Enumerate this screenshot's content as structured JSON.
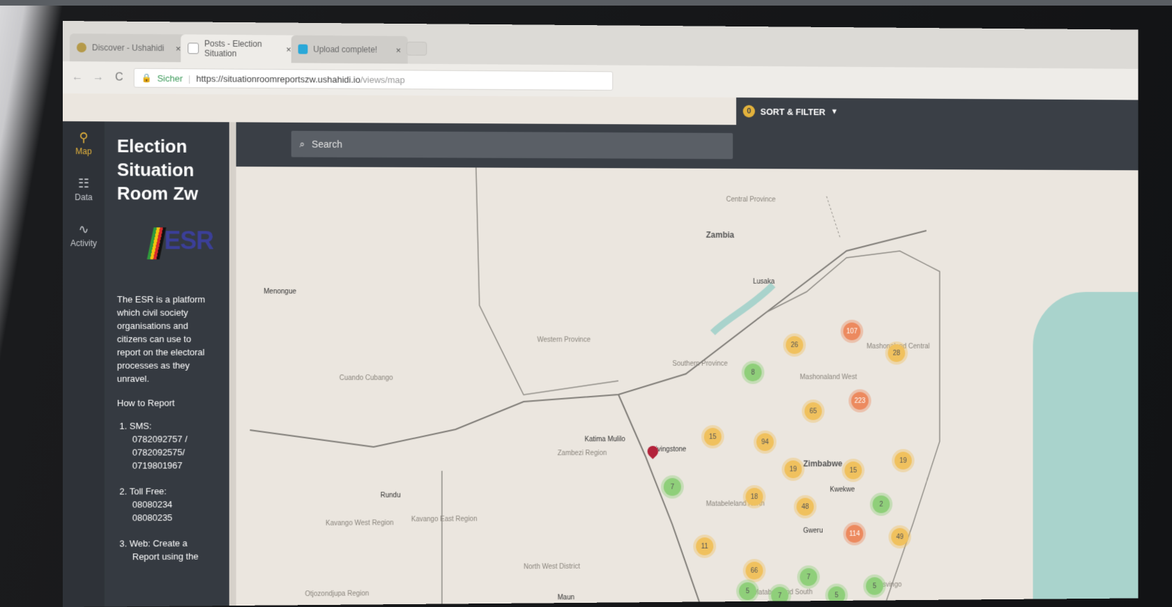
{
  "browser": {
    "tabs": [
      {
        "label": "Discover - Ushahidi",
        "close": "×"
      },
      {
        "label": "Posts - Election Situation",
        "close": "×"
      },
      {
        "label": "Upload complete!",
        "close": "×"
      }
    ],
    "nav": {
      "back": "←",
      "forward": "→",
      "reload": "C"
    },
    "address": {
      "secure_label": "Sicher",
      "host": "https://situationroomreportszw.ushahidi.io",
      "path": "/views/map"
    }
  },
  "rail": {
    "items": [
      {
        "label": "Map",
        "icon": "map-pin-icon"
      },
      {
        "label": "Data",
        "icon": "data-list-icon"
      },
      {
        "label": "Activity",
        "icon": "activity-icon"
      }
    ]
  },
  "panel": {
    "title": "Election Situation Room Zw",
    "logo_text": "ESR",
    "description": "The ESR is a platform which civil society organisations and citizens can use to report on the electoral processes as they unravel.",
    "how_to": "How to Report",
    "steps": [
      {
        "title": "SMS:",
        "lines": [
          "0782092757 /",
          "0782092575/",
          "0719801967"
        ]
      },
      {
        "title": "Toll Free:",
        "lines": [
          "08080234",
          "08080235"
        ]
      },
      {
        "title": "Web: Create a",
        "lines": [
          "Report using the"
        ]
      }
    ]
  },
  "mapbar": {
    "search_placeholder": "Search",
    "sort_filter_label": "SORT & FILTER",
    "filter_count": "0",
    "add_label": "+"
  },
  "map": {
    "labels": {
      "zambia": "Zambia",
      "zimbabwe": "Zimbabwe",
      "lusaka": "Lusaka",
      "menongue": "Menongue",
      "western_province": "Western Province",
      "southern_province": "Southern Province",
      "cuando_cubango": "Cuando Cubango",
      "zambezi_region": "Zambezi Region",
      "katima_mulilo": "Katima Mulilo",
      "livingstone": "Livingstone",
      "rundu": "Rundu",
      "kavango_west": "Kavango West Region",
      "kavango_east": "Kavango East Region",
      "north_west_district": "North West District",
      "maun": "Maun",
      "otjozondjupa": "Otjozondjupa Region",
      "mashonaland_west": "Mashonaland West",
      "mashonaland_central": "Mashonaland Central",
      "matabeleland_north": "Matabeleland North",
      "matabeleland_south": "Matabeleland South",
      "kwekwe": "Kwekwe",
      "gweru": "Gweru",
      "masvingo": "Masvingo",
      "central_province": "Central Province"
    },
    "clusters": [
      {
        "value": "107",
        "color": "orange"
      },
      {
        "value": "26",
        "color": "yellow"
      },
      {
        "value": "28",
        "color": "yellow"
      },
      {
        "value": "8",
        "color": "green"
      },
      {
        "value": "65",
        "color": "yellow"
      },
      {
        "value": "223",
        "color": "orange"
      },
      {
        "value": "15",
        "color": "yellow"
      },
      {
        "value": "94",
        "color": "yellow"
      },
      {
        "value": "19",
        "color": "yellow"
      },
      {
        "value": "15",
        "color": "yellow"
      },
      {
        "value": "19",
        "color": "yellow"
      },
      {
        "value": "7",
        "color": "green"
      },
      {
        "value": "18",
        "color": "yellow"
      },
      {
        "value": "48",
        "color": "yellow"
      },
      {
        "value": "2",
        "color": "green"
      },
      {
        "value": "11",
        "color": "yellow"
      },
      {
        "value": "114",
        "color": "orange"
      },
      {
        "value": "49",
        "color": "yellow"
      },
      {
        "value": "66",
        "color": "yellow"
      },
      {
        "value": "7",
        "color": "green"
      },
      {
        "value": "5",
        "color": "green"
      },
      {
        "value": "7",
        "color": "green"
      },
      {
        "value": "5",
        "color": "green"
      },
      {
        "value": "5",
        "color": "green"
      }
    ]
  },
  "colors": {
    "accent": "#e3b23c",
    "sidebar": "#353a41",
    "pin": "#b3223a"
  }
}
